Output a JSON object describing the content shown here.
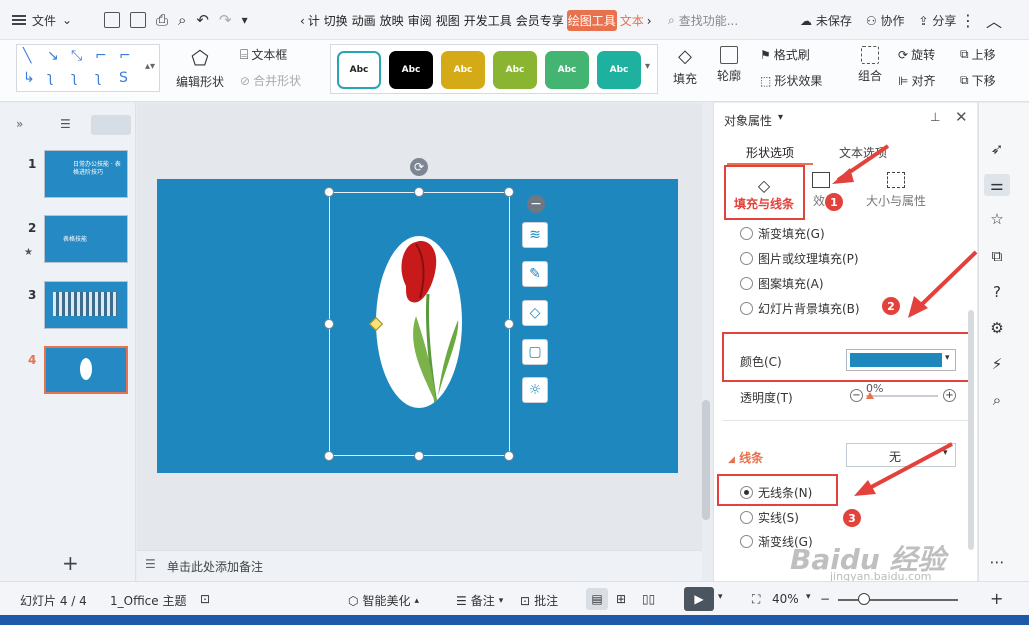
{
  "menu": {
    "file_label": "文件"
  },
  "tabs": [
    "计 切换",
    "动画",
    "放映",
    "审阅",
    "视图",
    "开发工具",
    "会员专享"
  ],
  "tab_active": "绘图工具",
  "tab_text_tool": "文本",
  "search": {
    "placeholder": "查找功能..."
  },
  "top_right": {
    "unsaved": "未保存",
    "collab": "协作",
    "share": "分享"
  },
  "ribbon": {
    "edit_shape": "编辑形状",
    "textbox": "文本框",
    "merge_shape": "合并形状",
    "style_label": "Abc",
    "fill": "填充",
    "outline": "轮廓",
    "format_brush": "格式刷",
    "shape_effect": "形状效果",
    "group": "组合",
    "rotate": "旋转",
    "align": "对齐",
    "move_up": "上移",
    "move_down": "下移"
  },
  "slides": [
    {
      "num": "1",
      "title": "日常办公技能 · 表格进阶技巧"
    },
    {
      "num": "2",
      "title": "表格技能"
    },
    {
      "num": "3",
      "title": ""
    },
    {
      "num": "4",
      "title": ""
    }
  ],
  "notes_placeholder": "单击此处添加备注",
  "panel": {
    "title": "对象属性",
    "tab_shape": "形状选项",
    "tab_text": "文本选项",
    "sub_fill_line": "填充与线条",
    "sub_effect": "效果",
    "sub_size": "大小与属性",
    "fill_options": [
      "渐变填充(G)",
      "图片或纹理填充(P)",
      "图案填充(A)",
      "幻灯片背景填充(B)"
    ],
    "color_label": "颜色(C)",
    "color_value": "#1d87be",
    "transparency_label": "透明度(T)",
    "transparency_value": "0%",
    "line_section": "线条",
    "line_dropdown": "无",
    "line_options": [
      "无线条(N)",
      "实线(S)",
      "渐变线(G)"
    ]
  },
  "callouts": [
    "1",
    "2",
    "3"
  ],
  "status": {
    "slide_info": "幻灯片 4 / 4",
    "theme": "1_Office 主题",
    "beautify": "智能美化",
    "notes": "备注",
    "comments": "批注",
    "zoom": "40%"
  },
  "watermark": "Baidu 经验",
  "watermark_url": "jingyan.baidu.com",
  "colors": {
    "accent": "#1d87be",
    "highlight": "#e2423b",
    "active_tab": "#e8714e"
  }
}
